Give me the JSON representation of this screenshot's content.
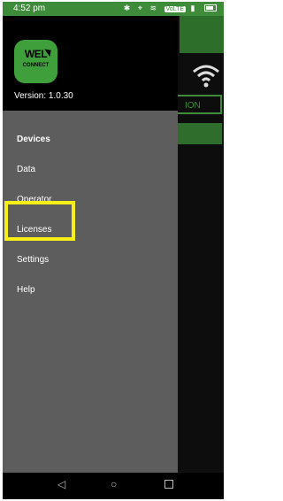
{
  "status_bar": {
    "time": "4:52 pm",
    "icons": [
      "bluetooth-icon",
      "location-icon",
      "wifi-icon",
      "volte-badge",
      "signal-icon",
      "battery-icon"
    ],
    "volte_text": "VoLTE"
  },
  "drawer": {
    "logo": {
      "line1": "WEL",
      "line2": "CONNECT"
    },
    "version": "Version: 1.0.30",
    "items": [
      {
        "label": "Devices",
        "bold": true
      },
      {
        "label": "Data"
      },
      {
        "label": "Operator"
      },
      {
        "label": "Licenses",
        "highlighted": true
      },
      {
        "label": "Settings"
      },
      {
        "label": "Help"
      }
    ]
  },
  "background_app": {
    "button_text": "ION"
  },
  "nav_bar": {
    "buttons": [
      "back-icon",
      "home-icon",
      "recent-apps-icon"
    ]
  },
  "colors": {
    "status_bar": "#3e8b3a",
    "drawer_bg": "#5d5d5d",
    "highlight": "#f7ef16",
    "logo_green": "#3f9f3a"
  }
}
